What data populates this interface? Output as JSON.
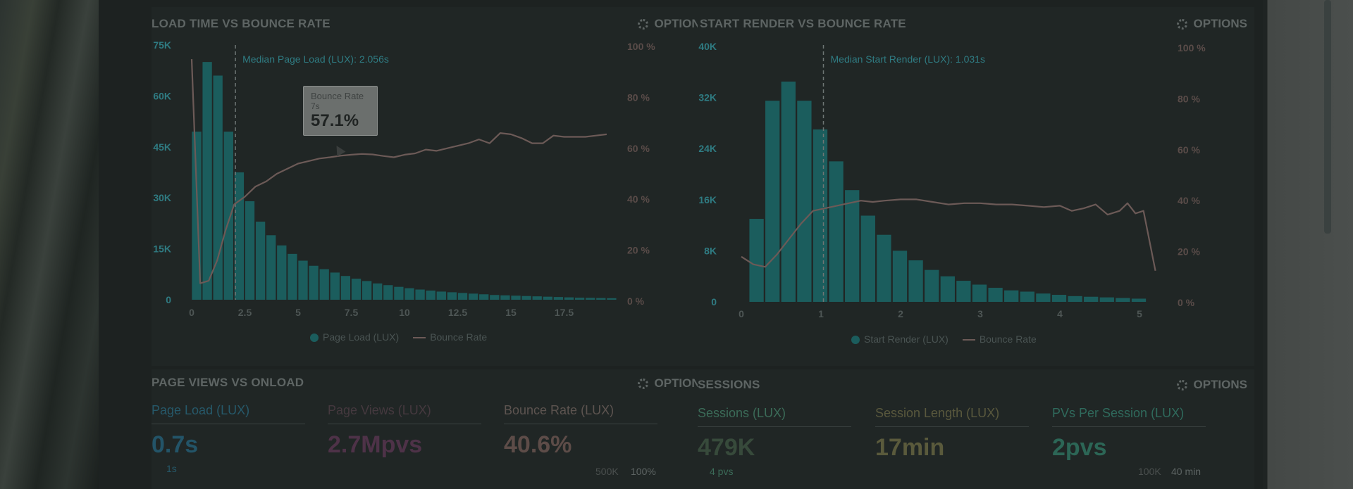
{
  "colors": {
    "teal": "#1b5d5d",
    "teal_text": "#2f7b82",
    "line": "#6c5a57",
    "muted": "#5e6564",
    "purple": "#4e3248",
    "salmon": "#5d4c48",
    "green_val": "#374a3b",
    "green_text": "#3b6b58",
    "olive": "#5a5a3c"
  },
  "load_panel": {
    "title": "LOAD TIME VS BOUNCE RATE",
    "options": "OPTIONS",
    "median_label": "Median Page Load (LUX): 2.056s",
    "tooltip": {
      "title": "Bounce Rate",
      "sub": "7s",
      "value": "57.1%"
    },
    "legend": {
      "bars": "Page Load (LUX)",
      "line": "Bounce Rate"
    }
  },
  "render_panel": {
    "title": "START RENDER VS BOUNCE RATE",
    "options": "OPTIONS",
    "median_label": "Median Start Render (LUX): 1.031s",
    "legend": {
      "bars": "Start Render (LUX)",
      "line": "Bounce Rate"
    }
  },
  "pageviews_panel": {
    "title": "PAGE VIEWS VS ONLOAD",
    "options": "OPTIONS",
    "metrics": [
      {
        "label": "Page Load (LUX)",
        "value": "0.7s"
      },
      {
        "label": "Page Views (LUX)",
        "value": "2.7Mpvs"
      },
      {
        "label": "Bounce Rate (LUX)",
        "value": "40.6%"
      }
    ],
    "axis_left": "1s",
    "axis_right_a": "500K",
    "axis_right_b": "100%"
  },
  "sessions_panel": {
    "title": "SESSIONS",
    "options": "OPTIONS",
    "metrics": [
      {
        "label": "Sessions (LUX)",
        "value": "479K"
      },
      {
        "label": "Session Length (LUX)",
        "value": "17min"
      },
      {
        "label": "PVs Per Session (LUX)",
        "value": "2pvs"
      }
    ],
    "axis_left": "4 pvs",
    "axis_right_a": "100K",
    "axis_right_b": "40 min"
  },
  "chart_data": [
    {
      "type": "bar",
      "title": "LOAD TIME VS BOUNCE RATE",
      "x": [
        0,
        0.5,
        1,
        1.5,
        2,
        2.5,
        3,
        3.5,
        4,
        4.5,
        5,
        5.5,
        6,
        6.5,
        7,
        7.5,
        8,
        8.5,
        9,
        9.5,
        10,
        10.5,
        11,
        11.5,
        12,
        12.5,
        13,
        13.5,
        14,
        14.5,
        15,
        15.5,
        16,
        16.5,
        17,
        17.5,
        18,
        18.5,
        19,
        19.5
      ],
      "x_ticks": [
        "0",
        "2.5",
        "5",
        "7.5",
        "10",
        "12.5",
        "15",
        "17.5"
      ],
      "y_ticks_left": [
        "0",
        "15K",
        "30K",
        "45K",
        "60K",
        "75K"
      ],
      "y_ticks_right": [
        "0 %",
        "20 %",
        "40 %",
        "60 %",
        "80 %",
        "100 %"
      ],
      "ylim_left": [
        0,
        75000
      ],
      "ylim_right": [
        0,
        100
      ],
      "median_x": 2.056,
      "series": [
        {
          "name": "Page Load (LUX)",
          "kind": "bar",
          "values": [
            49500,
            70000,
            66000,
            49500,
            37500,
            29000,
            23000,
            19000,
            16000,
            13500,
            11500,
            10000,
            9000,
            8000,
            7000,
            6200,
            5500,
            4800,
            4300,
            3800,
            3400,
            3000,
            2700,
            2400,
            2200,
            2000,
            1800,
            1600,
            1400,
            1300,
            1200,
            1100,
            1000,
            900,
            800,
            700,
            600,
            550,
            500,
            450
          ]
        },
        {
          "name": "Bounce Rate",
          "kind": "line",
          "x": [
            0,
            0.4,
            0.8,
            1.2,
            1.6,
            2,
            2.5,
            3,
            3.5,
            4,
            4.5,
            5,
            5.5,
            6,
            6.5,
            7,
            7.5,
            8,
            8.5,
            9,
            9.5,
            10,
            10.5,
            11,
            11.5,
            12,
            12.5,
            13,
            13.5,
            14,
            14.5,
            15,
            15.5,
            16,
            16.5,
            17,
            17.5,
            18,
            18.5,
            19,
            19.5
          ],
          "values": [
            95,
            7,
            8,
            16,
            28,
            38,
            41,
            45,
            47,
            50,
            52,
            54,
            55,
            56,
            56.5,
            57.1,
            57.5,
            57.8,
            57.6,
            57,
            56.5,
            57.5,
            58,
            59.5,
            59,
            60,
            61,
            62,
            63.5,
            62,
            66,
            65.5,
            64,
            62,
            62,
            65,
            64.5,
            64.5,
            64.5,
            65,
            65.5
          ]
        }
      ]
    },
    {
      "type": "bar",
      "title": "START RENDER VS BOUNCE RATE",
      "x": [
        0.2,
        0.4,
        0.6,
        0.8,
        1,
        1.2,
        1.4,
        1.6,
        1.8,
        2,
        2.2,
        2.4,
        2.6,
        2.8,
        3,
        3.2,
        3.4,
        3.6,
        3.8,
        4,
        4.2,
        4.4,
        4.6,
        4.8,
        5
      ],
      "x_ticks": [
        "0",
        "1",
        "2",
        "3",
        "4",
        "5"
      ],
      "y_ticks_left": [
        "0",
        "8K",
        "16K",
        "24K",
        "32K",
        "40K"
      ],
      "y_ticks_right": [
        "0 %",
        "20 %",
        "40 %",
        "60 %",
        "80 %",
        "100 %"
      ],
      "ylim_left": [
        0,
        40000
      ],
      "ylim_right": [
        0,
        100
      ],
      "median_x": 1.031,
      "series": [
        {
          "name": "Start Render (LUX)",
          "kind": "bar",
          "values": [
            13000,
            31500,
            34500,
            31500,
            27000,
            22000,
            17500,
            13500,
            10500,
            8000,
            6500,
            5000,
            4000,
            3300,
            2700,
            2200,
            1800,
            1600,
            1300,
            1100,
            900,
            800,
            700,
            600,
            500
          ]
        },
        {
          "name": "Bounce Rate",
          "kind": "line",
          "x": [
            0,
            0.15,
            0.3,
            0.45,
            0.6,
            0.75,
            0.9,
            1.05,
            1.2,
            1.35,
            1.5,
            1.65,
            1.8,
            2,
            2.2,
            2.4,
            2.6,
            2.8,
            3,
            3.2,
            3.4,
            3.6,
            3.8,
            4,
            4.15,
            4.3,
            4.45,
            4.6,
            4.75,
            4.85,
            4.95,
            5.05,
            5.2
          ],
          "values": [
            18,
            15,
            14,
            19,
            25,
            31,
            36,
            37,
            38,
            39,
            40,
            39.5,
            40,
            40.5,
            40.5,
            39.5,
            38.5,
            39,
            39,
            38.5,
            38.5,
            38,
            37.5,
            38,
            36,
            37,
            38.5,
            34.5,
            36,
            39,
            35,
            36,
            12.5
          ]
        }
      ]
    }
  ]
}
